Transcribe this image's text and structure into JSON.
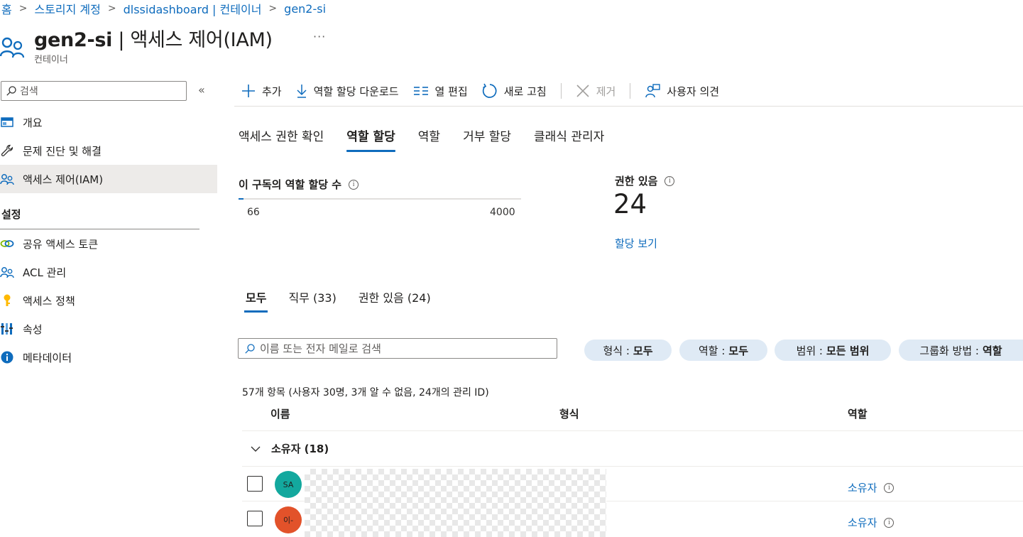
{
  "breadcrumb": [
    "홈",
    "스토리지 계정",
    "dlssidashboard | 컨테이너",
    "gen2-si"
  ],
  "header": {
    "title_bold": "gen2-si",
    "title_rest": " | 액세스 제어(IAM)",
    "more": "···",
    "subtitle": "컨테이너"
  },
  "sidebar": {
    "search_placeholder": "검색",
    "collapse": "«",
    "items": [
      {
        "label": "개요",
        "icon": "overview-icon"
      },
      {
        "label": "문제 진단 및 해결",
        "icon": "wrench-icon"
      },
      {
        "label": "액세스 제어(IAM)",
        "icon": "people-icon"
      }
    ],
    "section_title": "설정",
    "settings_items": [
      {
        "label": "공유 액세스 토큰",
        "icon": "link-icon"
      },
      {
        "label": "ACL 관리",
        "icon": "people-icon"
      },
      {
        "label": "액세스 정책",
        "icon": "key-icon"
      },
      {
        "label": "속성",
        "icon": "properties-icon"
      },
      {
        "label": "메타데이터",
        "icon": "info-icon"
      }
    ]
  },
  "toolbar": {
    "add": "추가",
    "download": "역할 할당 다운로드",
    "edit_columns": "열 편집",
    "refresh": "새로 고침",
    "remove": "제거",
    "feedback": "사용자 의견"
  },
  "tabs": [
    "액세스 권한 확인",
    "역할 할당",
    "역할",
    "거부 할당",
    "클래식 관리자"
  ],
  "active_tab": "역할 할당",
  "count_card": {
    "title": "이 구독의 역할 할당 수",
    "current": 66,
    "max": 4000,
    "current_label": "66",
    "max_label": "4000"
  },
  "permission_card": {
    "title": "권한 있음",
    "value": "24",
    "link": "할당 보기"
  },
  "subtabs": [
    "모두",
    "직무 (33)",
    "권한 있음 (24)"
  ],
  "filter": {
    "search_placeholder": "이름 또는 전자 메일로 검색",
    "pills": [
      {
        "key": "형식 :",
        "value": "모두"
      },
      {
        "key": "역할 :",
        "value": "모두"
      },
      {
        "key": "범위 :",
        "value": "모든 범위"
      },
      {
        "key": "그룹화 방법 :",
        "value": "역할"
      }
    ]
  },
  "table": {
    "summary": "57개 항목 (사용자 30명, 3개 알 수 없음, 24개의 관리 ID)",
    "columns": [
      "이름",
      "형식",
      "역할"
    ],
    "group_label": "소유자 (18)",
    "rows": [
      {
        "initials": "SA",
        "avatar_color": "#13a89e",
        "role": "소유자"
      },
      {
        "initials": "이-",
        "avatar_color": "#e2522a",
        "role": "소유자"
      }
    ]
  },
  "colors": {
    "accent": "#0f6cbd",
    "pill_bg": "#dfeaf5",
    "active_nav": "#edebe9"
  }
}
